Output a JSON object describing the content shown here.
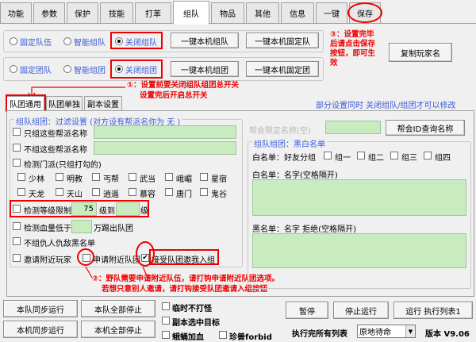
{
  "tabs": [
    "功能",
    "参数",
    "保护",
    "技能",
    "打苯",
    "组队",
    "物品",
    "其他",
    "信息",
    "一键",
    "保存"
  ],
  "active_tab": "组队",
  "top": {
    "radio_row1": [
      "固定队伍",
      "智能组队",
      "关闭组队"
    ],
    "radio_row2": [
      "固定团队",
      "智能组团",
      "关闭组团"
    ],
    "btn_one_key_team": "一键本机组队",
    "btn_one_key_fixed_team": "一键本机固定队",
    "btn_one_key_group": "一键本机组团",
    "btn_one_key_fixed_group": "一键本机固定团",
    "btn_copy_player": "复制玩家名",
    "note_save_line1": "③：设置完毕",
    "note_save_line2": "后请点击保存",
    "note_save_line3": "按钮，即可生",
    "note_save_line4": "效",
    "note_step1_line1": "①：设置前要关闭组队组团总开关",
    "note_step1_line2": "设置完后开启总开关"
  },
  "subtabs": [
    "队团通用",
    "队团单独",
    "副本设置"
  ],
  "info_note": "部分设置同时 关闭组队/组团才可以修改",
  "left": {
    "section_title": "组队组团：过滤设置 (对方设有帮派名你为 无 )",
    "only_guild": "只组这些帮派名称",
    "not_guild": "不组这些帮派名称",
    "detect_sect": "检测门派(只组打勾的)",
    "sects_row1": [
      "少林",
      "明教",
      "丐帮",
      "武当",
      "峨嵋",
      "星宿"
    ],
    "sects_row2": [
      "天龙",
      "天山",
      "逍遥",
      "慕容",
      "唐门",
      "鬼谷"
    ],
    "level_limit": "检测等级限制",
    "level_from": "75",
    "level_to_label": "级到",
    "level_unit": "级",
    "hp_below": "检测血量低于",
    "hp_unit": "万踢出队团",
    "no_enemy": "不组仇人仇敌黑名单",
    "invite_nearby": "邀请附近玩家",
    "apply_nearby": "申请附近队团",
    "accept_invite": "接受队团邀我入组",
    "note_step2_line1": "②：野队需要申请附近队伍，请打钩申请附近队团选项。",
    "note_step2_line2": "若想只意别人邀请，请打钩接受队团邀请入组按钮"
  },
  "right": {
    "guild_placeholder": "帮会限定名称(空)",
    "guild_id_btn": "帮会ID查询名称",
    "blackwhite_title": "组队组团：黑白名单",
    "white_list": "白名单：好友分组",
    "groups": [
      "组一",
      "组二",
      "组三",
      "组四"
    ],
    "white_names": "白名单：名字(空格隔开)",
    "black_names": "黑名单：名字 拒绝(空格隔开)"
  },
  "bottom": {
    "btn_sync_team": "本队同步运行",
    "btn_stop_team": "本队全部停止",
    "btn_sync_machine": "本机同步运行",
    "btn_stop_machine": "本机全部停止",
    "chk_temp_no_fight": "临时不打怪",
    "chk_copy_target": "副本选中目标",
    "chk_moth": "蛾蛹加血",
    "chk_pearl": "珍兽forbid",
    "btn_pause": "暂停",
    "btn_stop_run": "停止运行",
    "btn_run_list": "运行 执行列表1",
    "list_done_label": "执行完所有列表",
    "list_done_value": "原地待命",
    "version": "版本 V9.06"
  }
}
